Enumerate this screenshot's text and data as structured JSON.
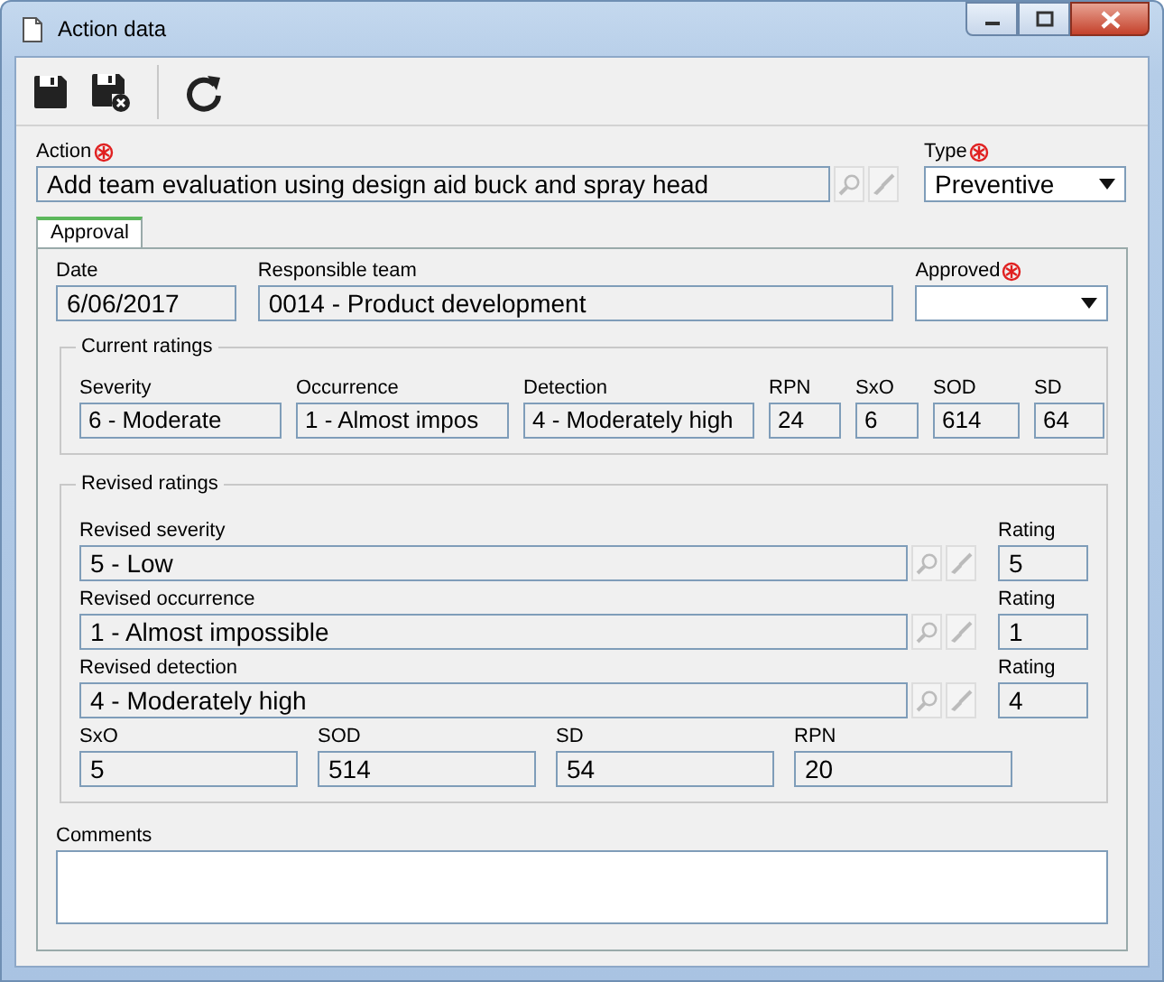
{
  "window": {
    "title": "Action data"
  },
  "action": {
    "label": "Action",
    "required": true,
    "value": "Add team evaluation using design aid buck and spray head"
  },
  "type": {
    "label": "Type",
    "required": true,
    "value": "Preventive"
  },
  "tabs": [
    {
      "label": "Approval",
      "selected": true
    }
  ],
  "date": {
    "label": "Date",
    "value": "6/06/2017"
  },
  "responsible_team": {
    "label": "Responsible team",
    "value": "0014 - Product development"
  },
  "approved": {
    "label": "Approved",
    "required": true
  },
  "current_ratings": {
    "title": "Current ratings",
    "fields": [
      {
        "label": "Severity",
        "value": "6 - Moderate"
      },
      {
        "label": "Occurrence",
        "value": "1 - Almost impos"
      },
      {
        "label": "Detection",
        "value": "4 - Moderately high"
      },
      {
        "label": "RPN",
        "value": "24"
      },
      {
        "label": "SxO",
        "value": "6"
      },
      {
        "label": "SOD",
        "value": "614"
      },
      {
        "label": "SD",
        "value": "64"
      }
    ]
  },
  "revised_ratings": {
    "title": "Revised ratings",
    "rows": [
      {
        "label": "Revised severity",
        "value": "5 - Low",
        "rating_label": "Rating",
        "rating": "5"
      },
      {
        "label": "Revised occurrence",
        "value": "1 - Almost impossible",
        "rating_label": "Rating",
        "rating": "1"
      },
      {
        "label": "Revised detection",
        "value": "4 - Moderately high",
        "rating_label": "Rating",
        "rating": "4"
      }
    ],
    "totals": [
      {
        "label": "SxO",
        "value": "5"
      },
      {
        "label": "SOD",
        "value": "514"
      },
      {
        "label": "SD",
        "value": "54"
      },
      {
        "label": "RPN",
        "value": "20"
      }
    ]
  },
  "comments": {
    "label": "Comments"
  }
}
